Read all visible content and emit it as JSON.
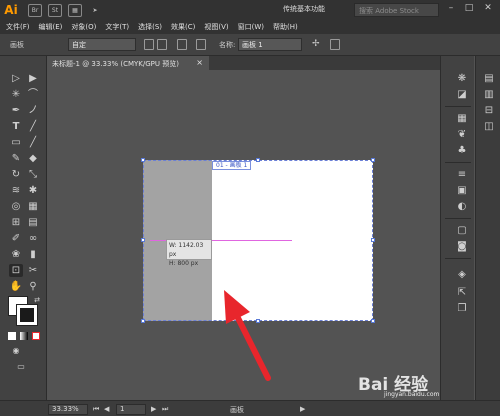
{
  "app": {
    "logo": "Ai",
    "bridge_label": "Br",
    "stock_label": "St",
    "workspace": "传统基本功能",
    "search_placeholder": "搜索 Adobe Stock"
  },
  "menu": [
    "文件(F)",
    "编辑(E)",
    "对象(O)",
    "文字(T)",
    "选择(S)",
    "效果(C)",
    "视图(V)",
    "窗口(W)",
    "帮助(H)"
  ],
  "control_bar": {
    "panel_label": "画板",
    "preset_value": "自定",
    "name_label": "名称:",
    "name_value": "画板 1"
  },
  "document": {
    "tab_title": "未标题-1 @ 33.33% (CMYK/GPU 预览)",
    "tab_close": "×",
    "artboard_label": "01 - 画板 1"
  },
  "measure_tooltip": {
    "width": "W: 1142.03 px",
    "height": "H: 800 px"
  },
  "status_bar": {
    "zoom": "33.33%",
    "page": "1",
    "tool_name": "画板"
  },
  "watermark": {
    "brand": "Bai 经验",
    "url": "jingyan.baidu.com"
  },
  "colors": {
    "accent": "#ff9a00",
    "arrow": "#e8262c",
    "selection": "#5a7ad6",
    "guide": "#e066e0"
  }
}
